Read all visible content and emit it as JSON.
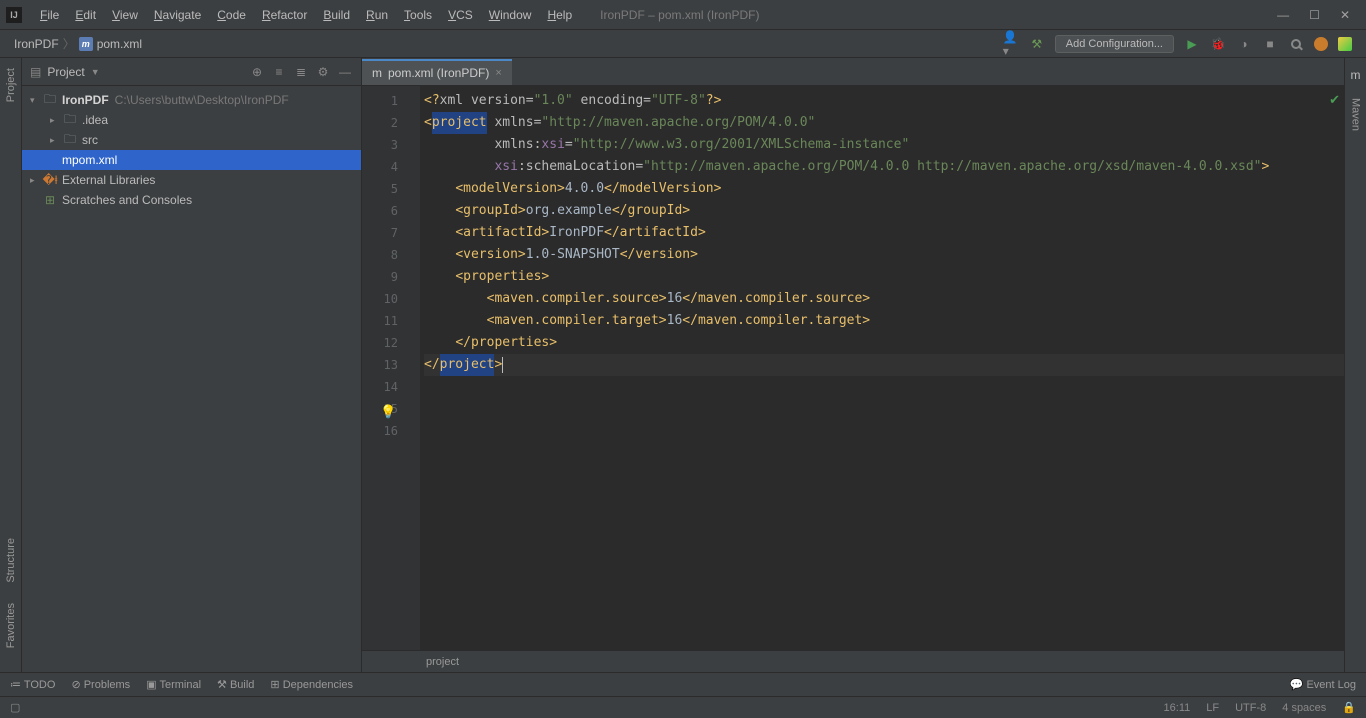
{
  "menubar": {
    "items": [
      "File",
      "Edit",
      "View",
      "Navigate",
      "Code",
      "Refactor",
      "Build",
      "Run",
      "Tools",
      "VCS",
      "Window",
      "Help"
    ],
    "title": "IronPDF – pom.xml (IronPDF)"
  },
  "breadcrumb": {
    "root": "IronPDF",
    "file": "pom.xml"
  },
  "toolbar": {
    "add_configuration": "Add Configuration..."
  },
  "project_panel": {
    "title": "Project",
    "tree": {
      "root": "IronPDF",
      "root_path": "C:\\Users\\buttw\\Desktop\\IronPDF",
      "children": [
        ".idea",
        "src",
        "pom.xml"
      ],
      "external": "External Libraries",
      "scratches": "Scratches and Consoles"
    }
  },
  "editor": {
    "tab_label": "pom.xml (IronPDF)",
    "breadcrumb": "project",
    "line_count": 16,
    "code_tokens": [
      [
        [
          "<?",
          "tag"
        ],
        [
          "xml version",
          "attr"
        ],
        [
          "=",
          "attr"
        ],
        [
          "\"1.0\"",
          "str"
        ],
        [
          " ",
          "text"
        ],
        [
          "encoding",
          "attr"
        ],
        [
          "=",
          "attr"
        ],
        [
          "\"UTF-8\"",
          "str"
        ],
        [
          "?>",
          "tag"
        ]
      ],
      [
        [
          "<",
          "tag"
        ],
        [
          "project",
          "tag",
          true
        ],
        [
          " ",
          "text"
        ],
        [
          "xmlns",
          "attr"
        ],
        [
          "=",
          "attr"
        ],
        [
          "\"http://maven.apache.org/POM/4.0.0\"",
          "str"
        ]
      ],
      [
        [
          "         ",
          "text"
        ],
        [
          "xmlns:",
          "attr"
        ],
        [
          "xsi",
          "ns"
        ],
        [
          "=",
          "attr"
        ],
        [
          "\"http://www.w3.org/2001/XMLSchema-instance\"",
          "str"
        ]
      ],
      [
        [
          "         ",
          "text"
        ],
        [
          "xsi",
          "ns"
        ],
        [
          ":",
          "attr"
        ],
        [
          "schemaLocation",
          "attr"
        ],
        [
          "=",
          "attr"
        ],
        [
          "\"http://maven.apache.org/POM/4.0.0 http://maven.apache.org/xsd/maven-4.0.0.xsd\"",
          "str"
        ],
        [
          ">",
          "tag"
        ]
      ],
      [
        [
          "    ",
          "text"
        ],
        [
          "<modelVersion>",
          "tag"
        ],
        [
          "4.0.0",
          "text"
        ],
        [
          "</modelVersion>",
          "tag"
        ]
      ],
      [
        [
          "",
          "text"
        ]
      ],
      [
        [
          "    ",
          "text"
        ],
        [
          "<groupId>",
          "tag"
        ],
        [
          "org.example",
          "text"
        ],
        [
          "</groupId>",
          "tag"
        ]
      ],
      [
        [
          "    ",
          "text"
        ],
        [
          "<artifactId>",
          "tag"
        ],
        [
          "IronPDF",
          "text"
        ],
        [
          "</artifactId>",
          "tag"
        ]
      ],
      [
        [
          "    ",
          "text"
        ],
        [
          "<version>",
          "tag"
        ],
        [
          "1.0-SNAPSHOT",
          "text"
        ],
        [
          "</version>",
          "tag"
        ]
      ],
      [
        [
          "",
          "text"
        ]
      ],
      [
        [
          "    ",
          "text"
        ],
        [
          "<properties>",
          "tag"
        ]
      ],
      [
        [
          "        ",
          "text"
        ],
        [
          "<maven.compiler.source>",
          "tag"
        ],
        [
          "16",
          "text"
        ],
        [
          "</maven.compiler.source>",
          "tag"
        ]
      ],
      [
        [
          "        ",
          "text"
        ],
        [
          "<maven.compiler.target>",
          "tag"
        ],
        [
          "16",
          "text"
        ],
        [
          "</maven.compiler.target>",
          "tag"
        ]
      ],
      [
        [
          "    ",
          "text"
        ],
        [
          "</properties>",
          "tag"
        ]
      ],
      [
        [
          "",
          "text"
        ]
      ],
      [
        [
          "</",
          "tag"
        ],
        [
          "project",
          "tag",
          true
        ],
        [
          ">",
          "tag"
        ]
      ]
    ]
  },
  "left_tools": {
    "project": "Project",
    "structure": "Structure",
    "favorites": "Favorites"
  },
  "right_tools": {
    "maven": "Maven"
  },
  "bottom_tools": {
    "todo": "TODO",
    "problems": "Problems",
    "terminal": "Terminal",
    "build": "Build",
    "dependencies": "Dependencies",
    "event_log": "Event Log"
  },
  "statusbar": {
    "position": "16:11",
    "line_ending": "LF",
    "encoding": "UTF-8",
    "indent": "4 spaces"
  }
}
